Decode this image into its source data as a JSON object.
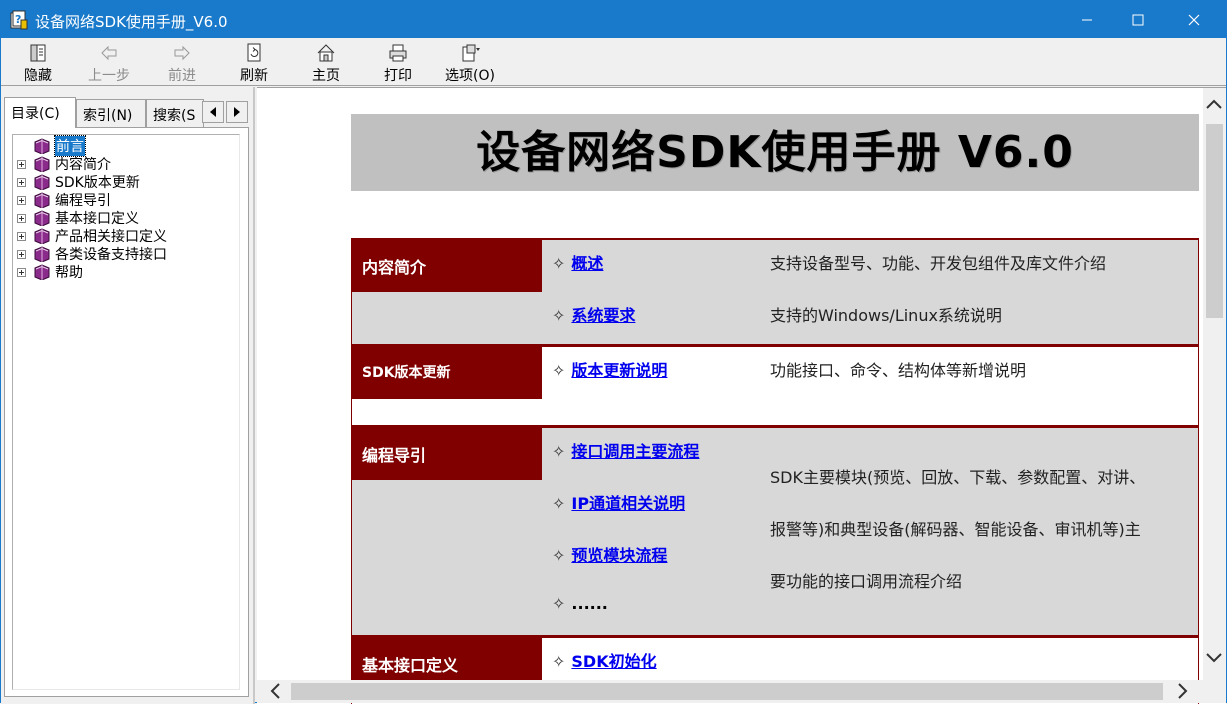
{
  "window": {
    "title": "设备网络SDK使用手册_V6.0"
  },
  "toolbar": {
    "hide": "隐藏",
    "back": "上一步",
    "forward": "前进",
    "refresh": "刷新",
    "home": "主页",
    "print": "打印",
    "options": "选项(O)"
  },
  "tabs": {
    "contents": "目录(C)",
    "index": "索引(N)",
    "search": "搜索(S"
  },
  "tree": {
    "items": [
      {
        "label": "前言",
        "expandable": false,
        "selected": true
      },
      {
        "label": "内容简介",
        "expandable": true
      },
      {
        "label": "SDK版本更新",
        "expandable": true
      },
      {
        "label": "编程导引",
        "expandable": true
      },
      {
        "label": "基本接口定义",
        "expandable": true
      },
      {
        "label": "产品相关接口定义",
        "expandable": true
      },
      {
        "label": "各类设备支持接口",
        "expandable": true
      },
      {
        "label": "帮助",
        "expandable": true
      }
    ]
  },
  "doc": {
    "title": "设备网络SDK使用手册 V6.0",
    "sections": [
      {
        "label": "内容简介",
        "links": [
          "概述",
          "系统要求"
        ],
        "descs": [
          "支持设备型号、功能、开发包组件及库文件介绍",
          "支持的Windows/Linux系统说明"
        ]
      },
      {
        "label": "SDK版本更新",
        "links": [
          "版本更新说明"
        ],
        "descs": [
          "功能接口、命令、结构体等新增说明"
        ]
      },
      {
        "label": "编程导引",
        "links": [
          "接口调用主要流程",
          "IP通道相关说明",
          "预览模块流程"
        ],
        "more": "......",
        "descs": [
          "SDK主要模块(预览、回放、下载、参数配置、对讲、",
          "报警等)和典型设备(解码器、智能设备、审讯机等)主",
          "要功能的接口调用流程介绍"
        ]
      },
      {
        "label": "基本接口定义",
        "links": [
          "SDK初始化"
        ]
      }
    ]
  },
  "colors": {
    "titlebar": "#1979ca",
    "section": "#800000",
    "link": "#0000ee"
  }
}
